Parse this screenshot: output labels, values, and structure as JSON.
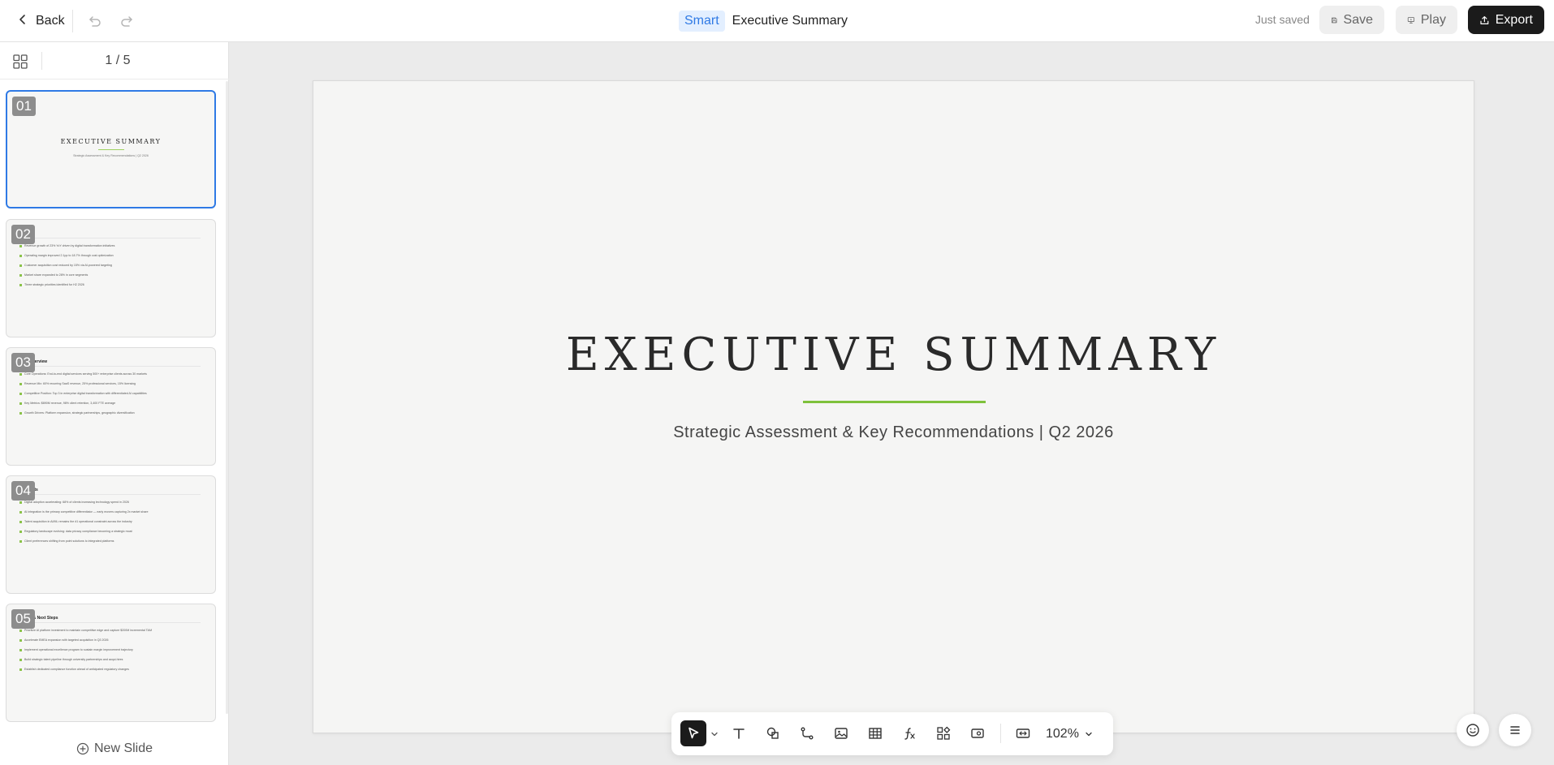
{
  "topbar": {
    "back_label": "Back",
    "smart_badge": "Smart",
    "title": "Executive Summary",
    "status": "Just saved",
    "save_label": "Save",
    "play_label": "Play",
    "export_label": "Export"
  },
  "sidebar": {
    "page_indicator": "1 / 5",
    "new_slide_label": "New Slide",
    "slides": [
      {
        "number": "01",
        "title": "EXECUTIVE SUMMARY",
        "subtitle": "Strategic Assessment & Key Recommendations | Q2 2026"
      },
      {
        "number": "02",
        "heading": "ights",
        "lines": [
          "Revenue growth of 23% YoY driven by digital transformation initiatives",
          "Operating margin improved 2.1pp to 18.7% through cost optimization",
          "Customer acquisition cost reduced by 15% via AI-powered targeting",
          "Market share expanded to 28% in core segments",
          "Three strategic priorities identified for H2 2026"
        ]
      },
      {
        "number": "03",
        "heading": "ss Overview",
        "lines": [
          "Core Operations: End-to-end digital services serving 500+ enterprise clients across 30 markets",
          "Revenue Mix: 60% recurring SaaS revenue, 25% professional services, 15% licensing",
          "Competitive Position: Top 3 in enterprise digital transformation with differentiated AI capabilities",
          "Key Metrics: $890M revenue, 98% client retention, 3,400 FTE average",
          "Growth Drivers: Platform expansion, strategic partnerships, geographic diversification"
        ]
      },
      {
        "number": "04",
        "heading": "nsights",
        "lines": [
          "Digital adoption accelerating: 68% of clients increasing technology spend in 2026",
          "AI integration is the primary competitive differentiator — early movers capturing 2x market share",
          "Talent acquisition in AI/ML remains the #1 operational constraint across the industry",
          "Regulatory landscape evolving: data privacy compliance becoming a strategic moat",
          "Client preferences shifting from point solutions to integrated platforms"
        ]
      },
      {
        "number": "05",
        "heading": "ions & Next Steps",
        "lines": [
          "Prioritize AI platform investment to maintain competitive edge and capture $200M incremental TAM",
          "Accelerate EMEA expansion with targeted acquisition in Q3 2026",
          "Implement operational excellence program to sustain margin improvement trajectory",
          "Build strategic talent pipeline through university partnerships and acqui-hires",
          "Establish dedicated compliance function ahead of anticipated regulatory changes"
        ]
      }
    ]
  },
  "slide": {
    "title": "EXECUTIVE SUMMARY",
    "subtitle": "Strategic Assessment & Key Recommendations | Q2 2026"
  },
  "toolbar": {
    "zoom": "102%",
    "tools": [
      "select-tool",
      "text-tool",
      "shape-tool",
      "connector-tool",
      "image-tool",
      "table-tool",
      "formula-tool",
      "component-tool",
      "media-tool",
      "fit-tool"
    ]
  },
  "colors": {
    "accent": "#2f7ae5",
    "divider_green": "#7ec13b",
    "export_bg": "#1b1b1b"
  }
}
